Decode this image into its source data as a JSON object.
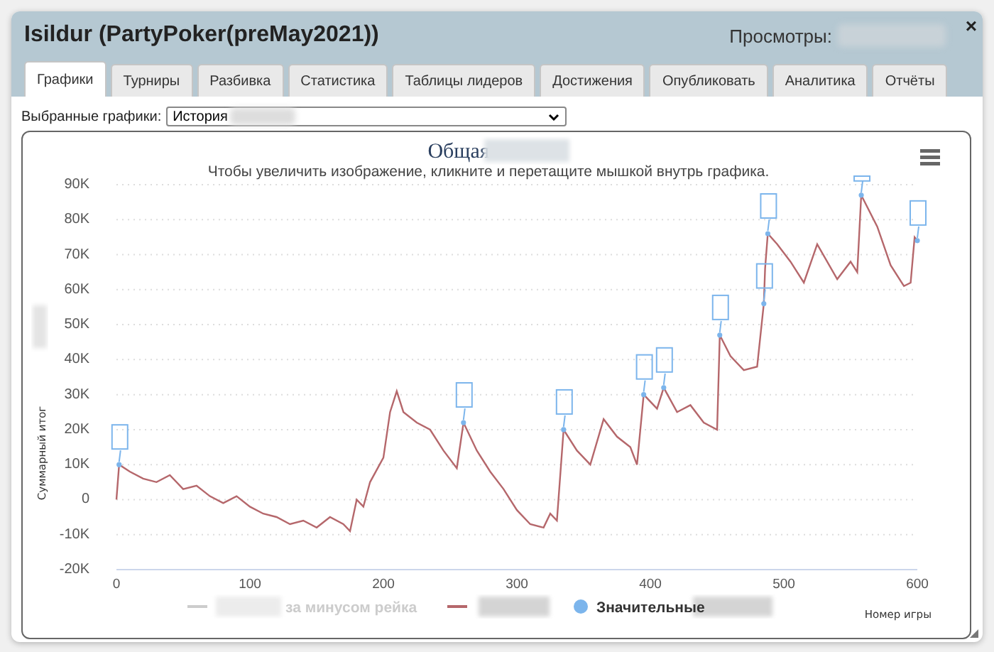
{
  "window": {
    "title": "Isildur (PartyPoker(preMay2021))",
    "views_label": "Просмотры:",
    "close": "×"
  },
  "tabs": [
    {
      "label": "Графики",
      "selected": true
    },
    {
      "label": "Турниры",
      "selected": false
    },
    {
      "label": "Разбивка",
      "selected": false
    },
    {
      "label": "Статистика",
      "selected": false
    },
    {
      "label": "Таблицы лидеров",
      "selected": false
    },
    {
      "label": "Достижения",
      "selected": false
    },
    {
      "label": "Опубликовать",
      "selected": false
    },
    {
      "label": "Аналитика",
      "selected": false
    },
    {
      "label": "Отчёты",
      "selected": false
    }
  ],
  "graph_select": {
    "label": "Выбранные графики:",
    "value": "История"
  },
  "chart": {
    "title": "Общая",
    "subtitle": "Чтобы увеличить изображение, кликните и перетащите мышкой внутрь графика.",
    "chart_data": {
      "type": "line",
      "grid": true,
      "xlabel": "Номер игры",
      "ylabel": "Суммарный итог",
      "xlim": [
        0,
        600
      ],
      "ylim": [
        -20000,
        90000
      ],
      "xticks": [
        0,
        100,
        200,
        300,
        400,
        500,
        600
      ],
      "yticks": [
        {
          "value": -20000,
          "label": "-20K"
        },
        {
          "value": -10000,
          "label": "-10K"
        },
        {
          "value": 0,
          "label": "0"
        },
        {
          "value": 10000,
          "label": "10K"
        },
        {
          "value": 20000,
          "label": "20K"
        },
        {
          "value": 30000,
          "label": "30K"
        },
        {
          "value": 40000,
          "label": "40K"
        },
        {
          "value": 50000,
          "label": "50K"
        },
        {
          "value": 60000,
          "label": "60K"
        },
        {
          "value": 70000,
          "label": "70K"
        },
        {
          "value": 80000,
          "label": "80K"
        },
        {
          "value": 90000,
          "label": "90K"
        }
      ],
      "x": [
        0,
        2,
        10,
        20,
        30,
        40,
        50,
        60,
        70,
        80,
        90,
        100,
        110,
        120,
        130,
        140,
        150,
        160,
        170,
        175,
        180,
        185,
        190,
        200,
        205,
        210,
        215,
        225,
        235,
        245,
        255,
        260,
        270,
        280,
        290,
        300,
        310,
        320,
        325,
        330,
        335,
        345,
        355,
        365,
        375,
        385,
        390,
        395,
        405,
        410,
        420,
        430,
        440,
        450,
        452,
        460,
        470,
        480,
        485,
        486,
        488,
        495,
        505,
        515,
        525,
        540,
        550,
        555,
        558,
        570,
        580,
        590,
        595,
        598,
        600
      ],
      "series": [
        {
          "color": "#b5676b",
          "values": [
            0,
            10000,
            8000,
            6000,
            5000,
            7000,
            3000,
            4000,
            1000,
            -1000,
            1000,
            -2000,
            -4000,
            -5000,
            -7000,
            -6000,
            -8000,
            -5000,
            -7000,
            -9000,
            0,
            -2000,
            5000,
            12000,
            25000,
            31000,
            25000,
            22000,
            20000,
            14000,
            9000,
            22000,
            14000,
            8000,
            3000,
            -3000,
            -7000,
            -8000,
            -4000,
            -6000,
            20000,
            14000,
            10000,
            23000,
            18000,
            15000,
            10000,
            30000,
            26000,
            32000,
            25000,
            27000,
            22000,
            20000,
            47000,
            41000,
            37000,
            38000,
            56000,
            66000,
            76000,
            73000,
            68000,
            62000,
            73000,
            63000,
            68000,
            65000,
            87000,
            78000,
            67000,
            61000,
            62000,
            75000,
            74000
          ]
        },
        {
          "name": "Значительные",
          "color": "#7cb5ec",
          "marker": true,
          "values": [
            null,
            10000,
            null,
            null,
            null,
            null,
            null,
            null,
            null,
            null,
            null,
            null,
            null,
            null,
            null,
            null,
            null,
            null,
            null,
            null,
            null,
            null,
            null,
            null,
            null,
            null,
            null,
            null,
            null,
            null,
            null,
            22000,
            null,
            null,
            null,
            null,
            null,
            null,
            null,
            null,
            20000,
            null,
            null,
            null,
            null,
            null,
            null,
            30000,
            null,
            32000,
            null,
            null,
            null,
            null,
            47000,
            null,
            null,
            null,
            56000,
            null,
            76000,
            null,
            null,
            null,
            null,
            null,
            null,
            null,
            87000,
            null,
            null,
            null,
            null,
            null,
            74000
          ]
        }
      ]
    },
    "legend": [
      {
        "kind": "line",
        "label": "за минусом рейка",
        "visible": false,
        "color": "#cccccc"
      },
      {
        "kind": "line",
        "visible": true,
        "color": "#b5676b"
      },
      {
        "kind": "dot",
        "visible": true,
        "color": "#7cb5ec"
      }
    ]
  }
}
